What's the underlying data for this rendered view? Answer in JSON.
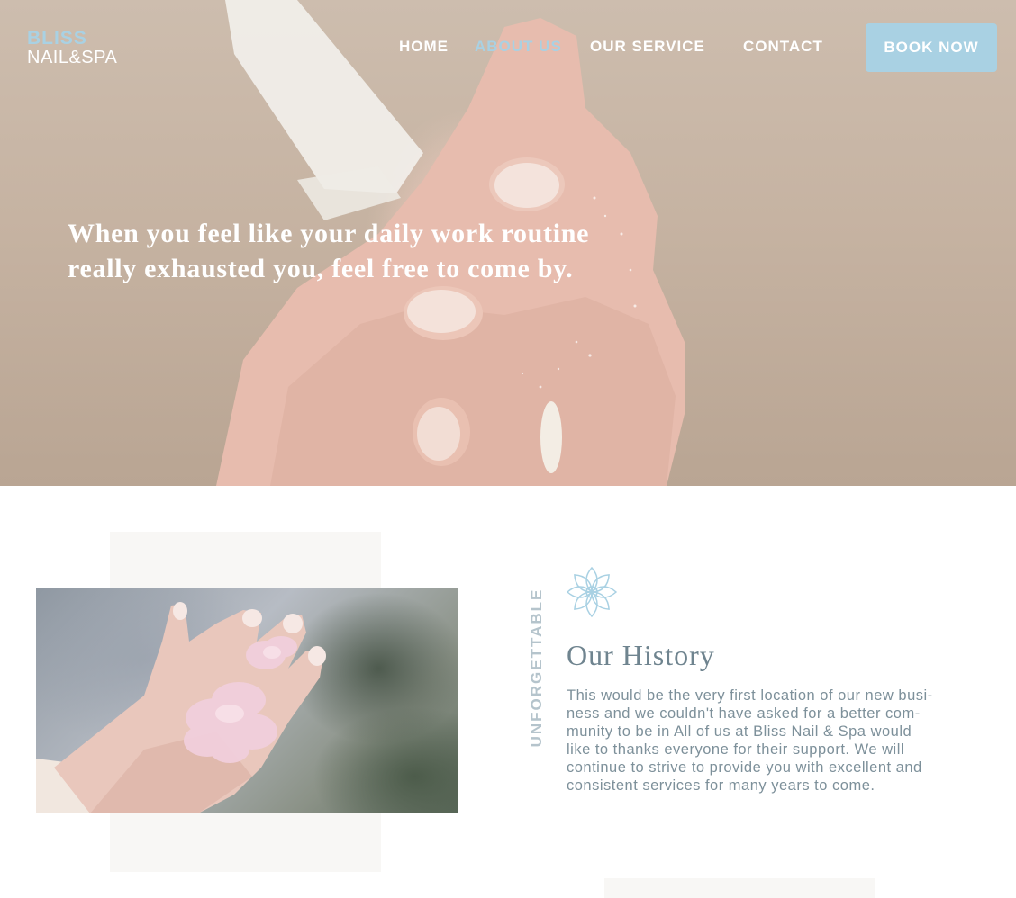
{
  "brand": {
    "name_top": "BLISS",
    "name_bottom": "NAIL&SPA"
  },
  "nav": {
    "items": [
      {
        "label": "HOME",
        "active": false
      },
      {
        "label": "ABOUT US",
        "active": true
      },
      {
        "label": "OUR SERVICE",
        "active": false
      },
      {
        "label": "CONTACT",
        "active": false
      }
    ],
    "cta_label": "BOOK NOW"
  },
  "hero": {
    "lines": [
      "When you feel like your daily work routine",
      "really exhausted you, feel free to come by."
    ]
  },
  "history": {
    "vertical_label": "UNFORGETTABLE",
    "title": "Our History",
    "body_lines": [
      "This would be the very first location of our new busi-",
      "ness and we couldn't have asked for a better com-",
      "munity to be in All of us at Bliss Nail & Spa would",
      "like to thanks everyone for their support. We will",
      "continue to strive to provide you with excellent and",
      "consistent services for many years to come."
    ]
  },
  "icons": {
    "section_icon": "lotus-icon"
  },
  "colors": {
    "accent": "#a9d1e3",
    "heading_text": "#6f848f",
    "body_text": "#7d909a",
    "panel_bg": "#f8f7f5"
  }
}
